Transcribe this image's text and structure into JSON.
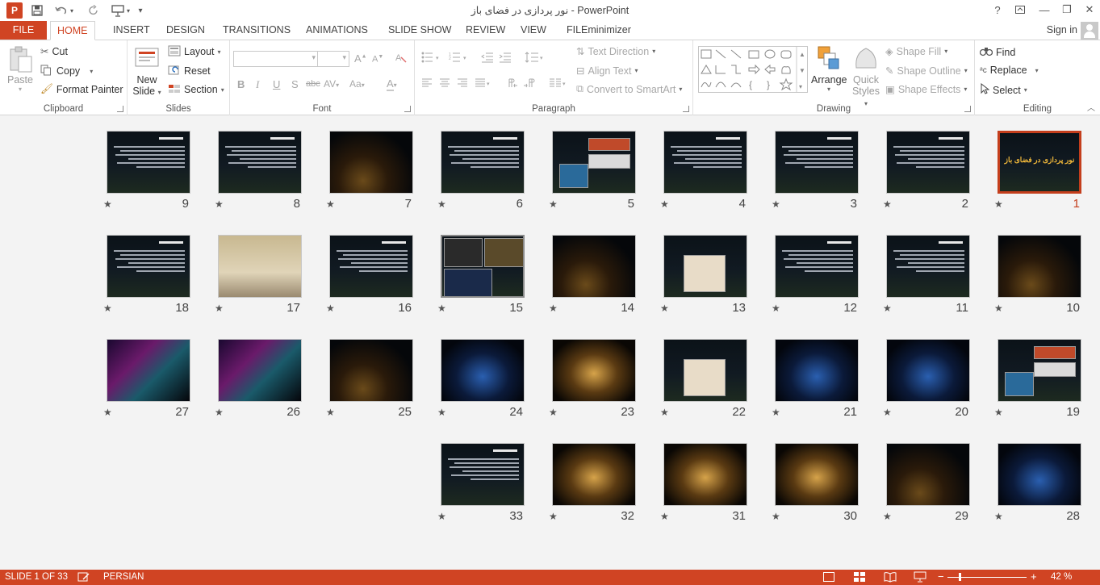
{
  "window": {
    "title": "نور پردازی در فضای باز - PowerPoint",
    "logo_letter": "P",
    "help": "?",
    "ribbon_display": "⊡",
    "minimize": "—",
    "restore": "❐",
    "close": "✕"
  },
  "qat": {
    "save": "save-icon",
    "undo": "undo-icon",
    "redo": "redo-icon",
    "present": "present-icon"
  },
  "tabs": [
    "FILE",
    "HOME",
    "INSERT",
    "DESIGN",
    "TRANSITIONS",
    "ANIMATIONS",
    "SLIDE SHOW",
    "REVIEW",
    "VIEW",
    "FILEminimizer"
  ],
  "active_tab": "HOME",
  "signin": "Sign in",
  "ribbon": {
    "clipboard": {
      "label": "Clipboard",
      "paste": "Paste",
      "cut": "Cut",
      "copy": "Copy",
      "format_painter": "Format Painter"
    },
    "slides": {
      "label": "Slides",
      "new_slide_1": "New",
      "new_slide_2": "Slide",
      "layout": "Layout",
      "reset": "Reset",
      "section": "Section"
    },
    "font": {
      "label": "Font",
      "font_name": "",
      "font_size": "",
      "bold": "B",
      "italic": "I",
      "underline": "U",
      "shadow": "S",
      "strike": "abc",
      "spacing": "AV",
      "case": "Aa",
      "color": "A",
      "grow": "A",
      "shrink": "A"
    },
    "paragraph": {
      "label": "Paragraph",
      "text_direction": "Text Direction",
      "align_text": "Align Text",
      "convert_smartart": "Convert to SmartArt"
    },
    "drawing": {
      "label": "Drawing",
      "arrange": "Arrange",
      "quick_1": "Quick",
      "quick_2": "Styles",
      "shape_fill": "Shape Fill",
      "shape_outline": "Shape Outline",
      "shape_effects": "Shape Effects"
    },
    "editing": {
      "label": "Editing",
      "find": "Find",
      "replace": "Replace",
      "select": "Select"
    }
  },
  "slides": [
    {
      "n": "1",
      "star": "★",
      "style": "title",
      "title": "نور پردازی در فضای باز",
      "selected": true
    },
    {
      "n": "2",
      "star": "★",
      "style": "text"
    },
    {
      "n": "3",
      "star": "★",
      "style": "text"
    },
    {
      "n": "4",
      "star": "★",
      "style": "text"
    },
    {
      "n": "5",
      "star": "★",
      "style": "pics"
    },
    {
      "n": "6",
      "star": "★",
      "style": "text"
    },
    {
      "n": "7",
      "star": "★",
      "style": "arch"
    },
    {
      "n": "8",
      "star": "★",
      "style": "text"
    },
    {
      "n": "9",
      "star": "★",
      "style": "text"
    },
    {
      "n": "10",
      "star": "★",
      "style": "building"
    },
    {
      "n": "11",
      "star": "★",
      "style": "text"
    },
    {
      "n": "12",
      "star": "★",
      "style": "text"
    },
    {
      "n": "13",
      "star": "★",
      "style": "photo"
    },
    {
      "n": "14",
      "star": "★",
      "style": "night"
    },
    {
      "n": "15",
      "star": "★",
      "style": "collage",
      "hovered": true
    },
    {
      "n": "16",
      "star": "★",
      "style": "text"
    },
    {
      "n": "17",
      "star": "★",
      "style": "pale"
    },
    {
      "n": "18",
      "star": "★",
      "style": "text"
    },
    {
      "n": "19",
      "star": "★",
      "style": "pics"
    },
    {
      "n": "20",
      "star": "★",
      "style": "blue"
    },
    {
      "n": "21",
      "star": "★",
      "style": "blue"
    },
    {
      "n": "22",
      "star": "★",
      "style": "photo"
    },
    {
      "n": "23",
      "star": "★",
      "style": "gold"
    },
    {
      "n": "24",
      "star": "★",
      "style": "blue"
    },
    {
      "n": "25",
      "star": "★",
      "style": "night"
    },
    {
      "n": "26",
      "star": "★",
      "style": "neon"
    },
    {
      "n": "27",
      "star": "★",
      "style": "neon"
    },
    {
      "n": "28",
      "star": "★",
      "style": "blue"
    },
    {
      "n": "29",
      "star": "★",
      "style": "night"
    },
    {
      "n": "30",
      "star": "★",
      "style": "gold"
    },
    {
      "n": "31",
      "star": "★",
      "style": "gold"
    },
    {
      "n": "32",
      "star": "★",
      "style": "gold"
    },
    {
      "n": "33",
      "star": "★",
      "style": "text"
    }
  ],
  "status": {
    "slide_info": "SLIDE 1 OF 33",
    "language": "PERSIAN",
    "zoom": "42 %",
    "zoom_minus": "−",
    "zoom_plus": "+"
  },
  "colors": {
    "accent": "#d04423",
    "selected_border": "#c43e1c"
  }
}
